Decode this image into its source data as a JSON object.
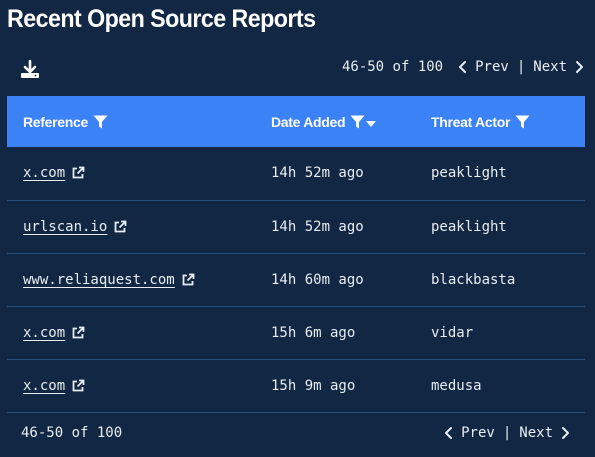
{
  "title": "Recent Open Source Reports",
  "pagination": {
    "range": "46-50 of 100",
    "prev_label": "Prev",
    "next_label": "Next",
    "separator": "|"
  },
  "table": {
    "columns": [
      "Reference",
      "Date Added",
      "Threat Actor"
    ],
    "rows": [
      {
        "reference": "x.com",
        "date_added": "14h 52m ago",
        "threat_actor": "peaklight"
      },
      {
        "reference": "urlscan.io",
        "date_added": "14h 52m ago",
        "threat_actor": "peaklight"
      },
      {
        "reference": "www.reliaquest.com",
        "date_added": "14h 60m ago",
        "threat_actor": "blackbasta"
      },
      {
        "reference": "x.com",
        "date_added": "15h 6m ago",
        "threat_actor": "vidar"
      },
      {
        "reference": "x.com",
        "date_added": "15h 9m ago",
        "threat_actor": "medusa"
      }
    ]
  },
  "icons": {
    "download": "download-icon",
    "filter": "filter-icon",
    "sort": "sort-desc-icon",
    "external_link": "external-link-icon",
    "prev": "chevron-left-icon",
    "next": "chevron-right-icon"
  },
  "colors": {
    "background": "#122743",
    "header_bar": "#3b82f6",
    "row_divider": "#2a4f7a",
    "text": "#e8edf3"
  }
}
